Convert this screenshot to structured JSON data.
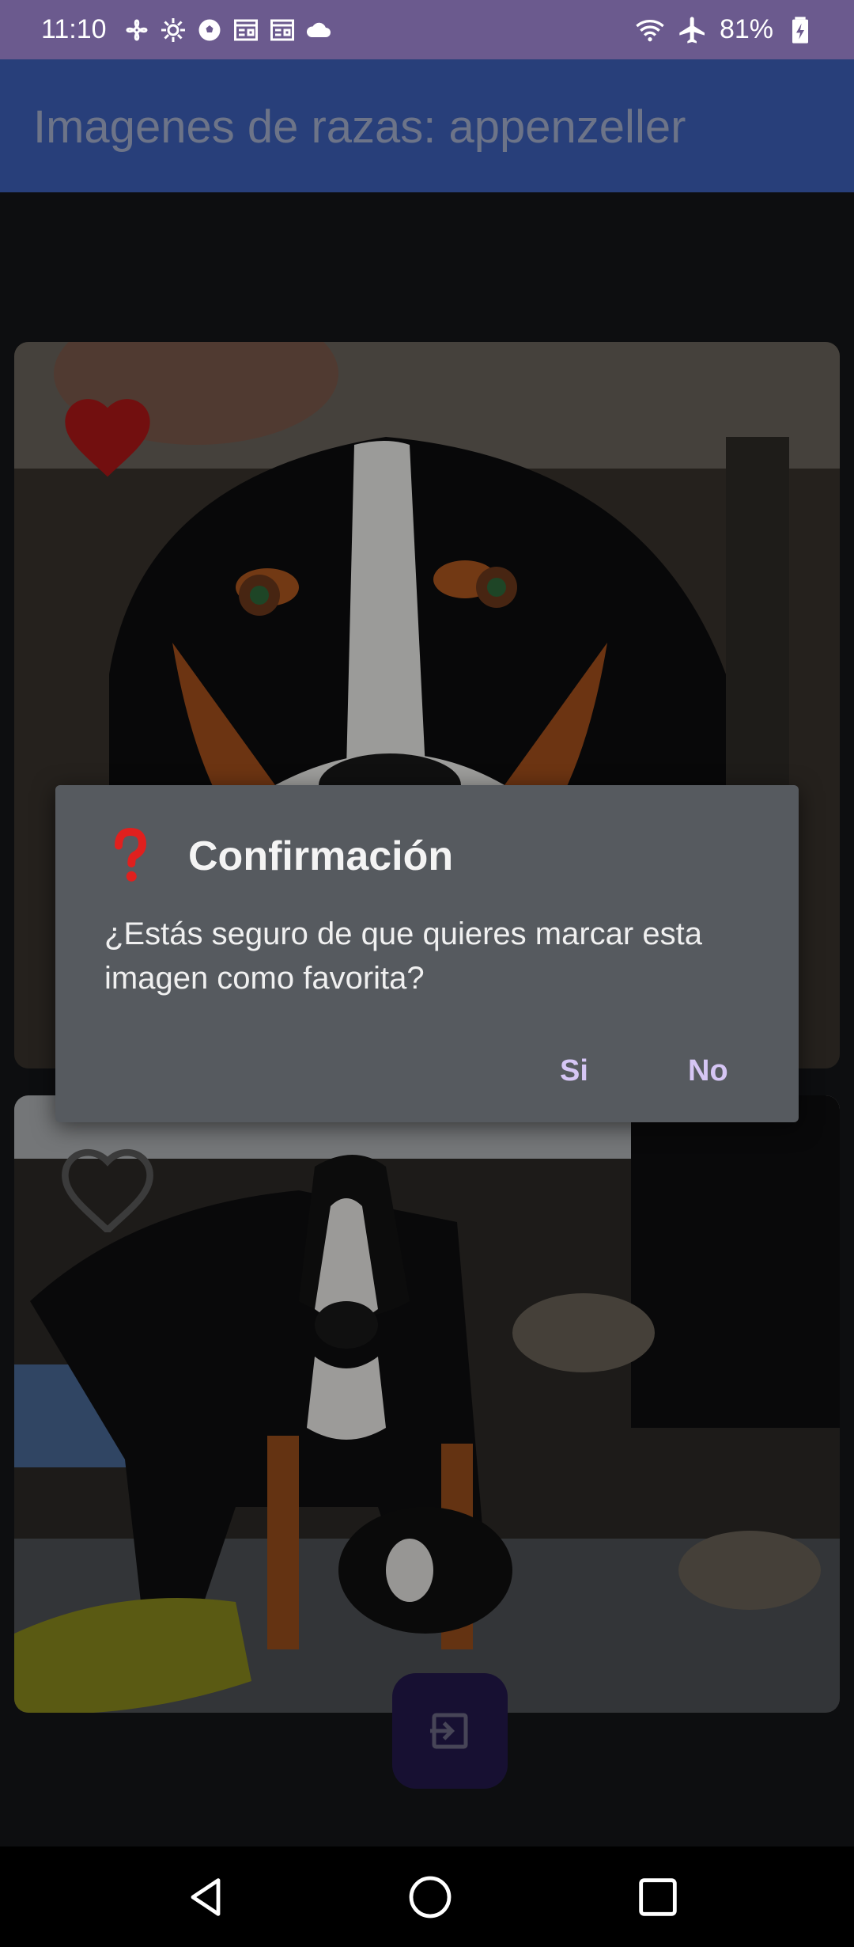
{
  "status_bar": {
    "time": "11:10",
    "battery": "81%",
    "icons": [
      "fan-icon",
      "gear-icon",
      "ball-icon",
      "news-icon",
      "news-icon",
      "cloud-icon"
    ],
    "right_icons": [
      "wifi-icon",
      "airplane-icon",
      "battery-icon"
    ]
  },
  "app_bar": {
    "title": "Imagenes de razas: appenzeller",
    "color": "#283f7a"
  },
  "cards": [
    {
      "favorite": true,
      "heart_color": "#7a1212"
    },
    {
      "favorite": false
    }
  ],
  "dialog": {
    "icon": "question-mark-icon",
    "title": "Confirmación",
    "message": "¿Estás seguro de que quieres marcar esta imagen como favorita?",
    "buttons": {
      "yes": "Si",
      "no": "No"
    },
    "accent": "#d6c6f5"
  },
  "fab": {
    "icon": "exit-to-app-icon",
    "color": "#241a4d"
  },
  "nav_bar": {
    "buttons": [
      "back-icon",
      "home-icon",
      "recents-icon"
    ]
  }
}
